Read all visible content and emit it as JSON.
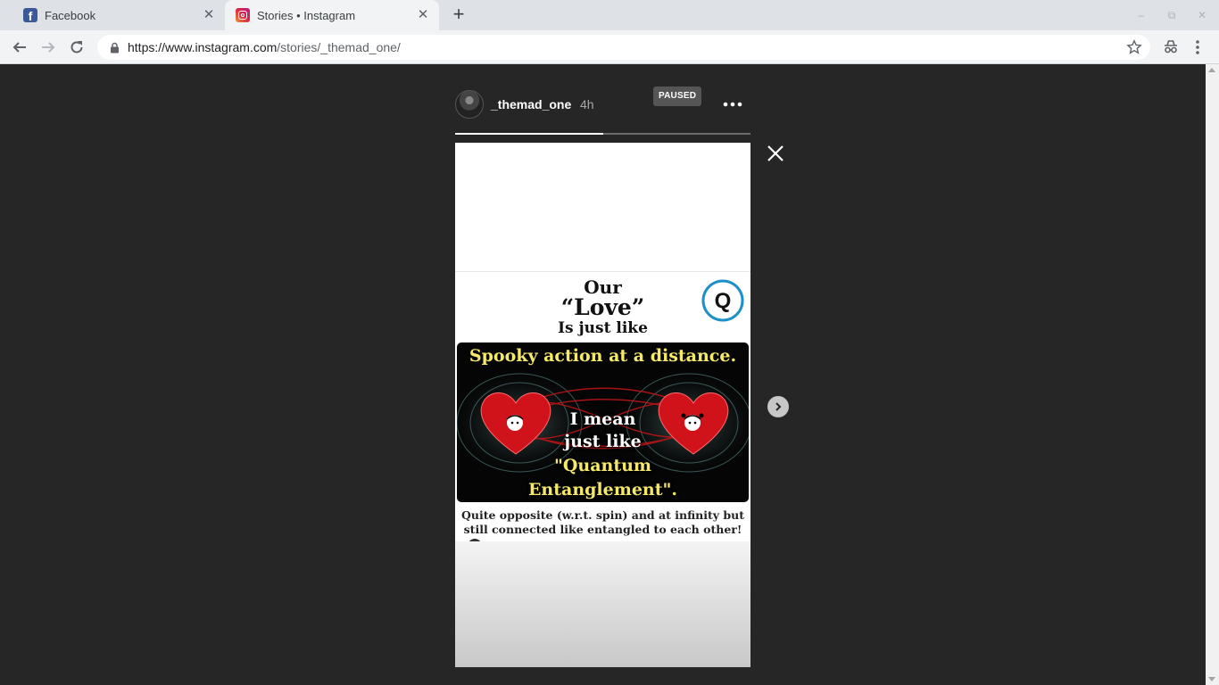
{
  "browser": {
    "tabs": [
      {
        "title": "Facebook",
        "favicon": "facebook-icon",
        "active": false
      },
      {
        "title": "Stories • Instagram",
        "favicon": "instagram-icon",
        "active": true
      }
    ],
    "url_host": "https://www.instagram.com",
    "url_path": "/stories/_themad_one/"
  },
  "story": {
    "username": "_themad_one",
    "time_ago": "4h",
    "status_badge": "PAUSED",
    "progress_fraction": 0.5,
    "content": {
      "line_our": "Our",
      "line_love": "“Love”",
      "line_just": "Is just like",
      "logo_letter": "Q",
      "poster_title": "Spooky action at a distance.",
      "poster_line1": "I mean",
      "poster_line2": "just like",
      "poster_line3": "\"Quantum",
      "poster_line4": "Entanglement\".",
      "caption_line1": "Quite opposite (w.r.t. spin) and at infinity but",
      "caption_line2": "still connected like entangled to each other!"
    }
  },
  "colors": {
    "page_bg": "#262626",
    "highlight_yellow": "#f6e96a",
    "heart_red": "#d0121b",
    "logo_blue": "#1e90c8"
  }
}
